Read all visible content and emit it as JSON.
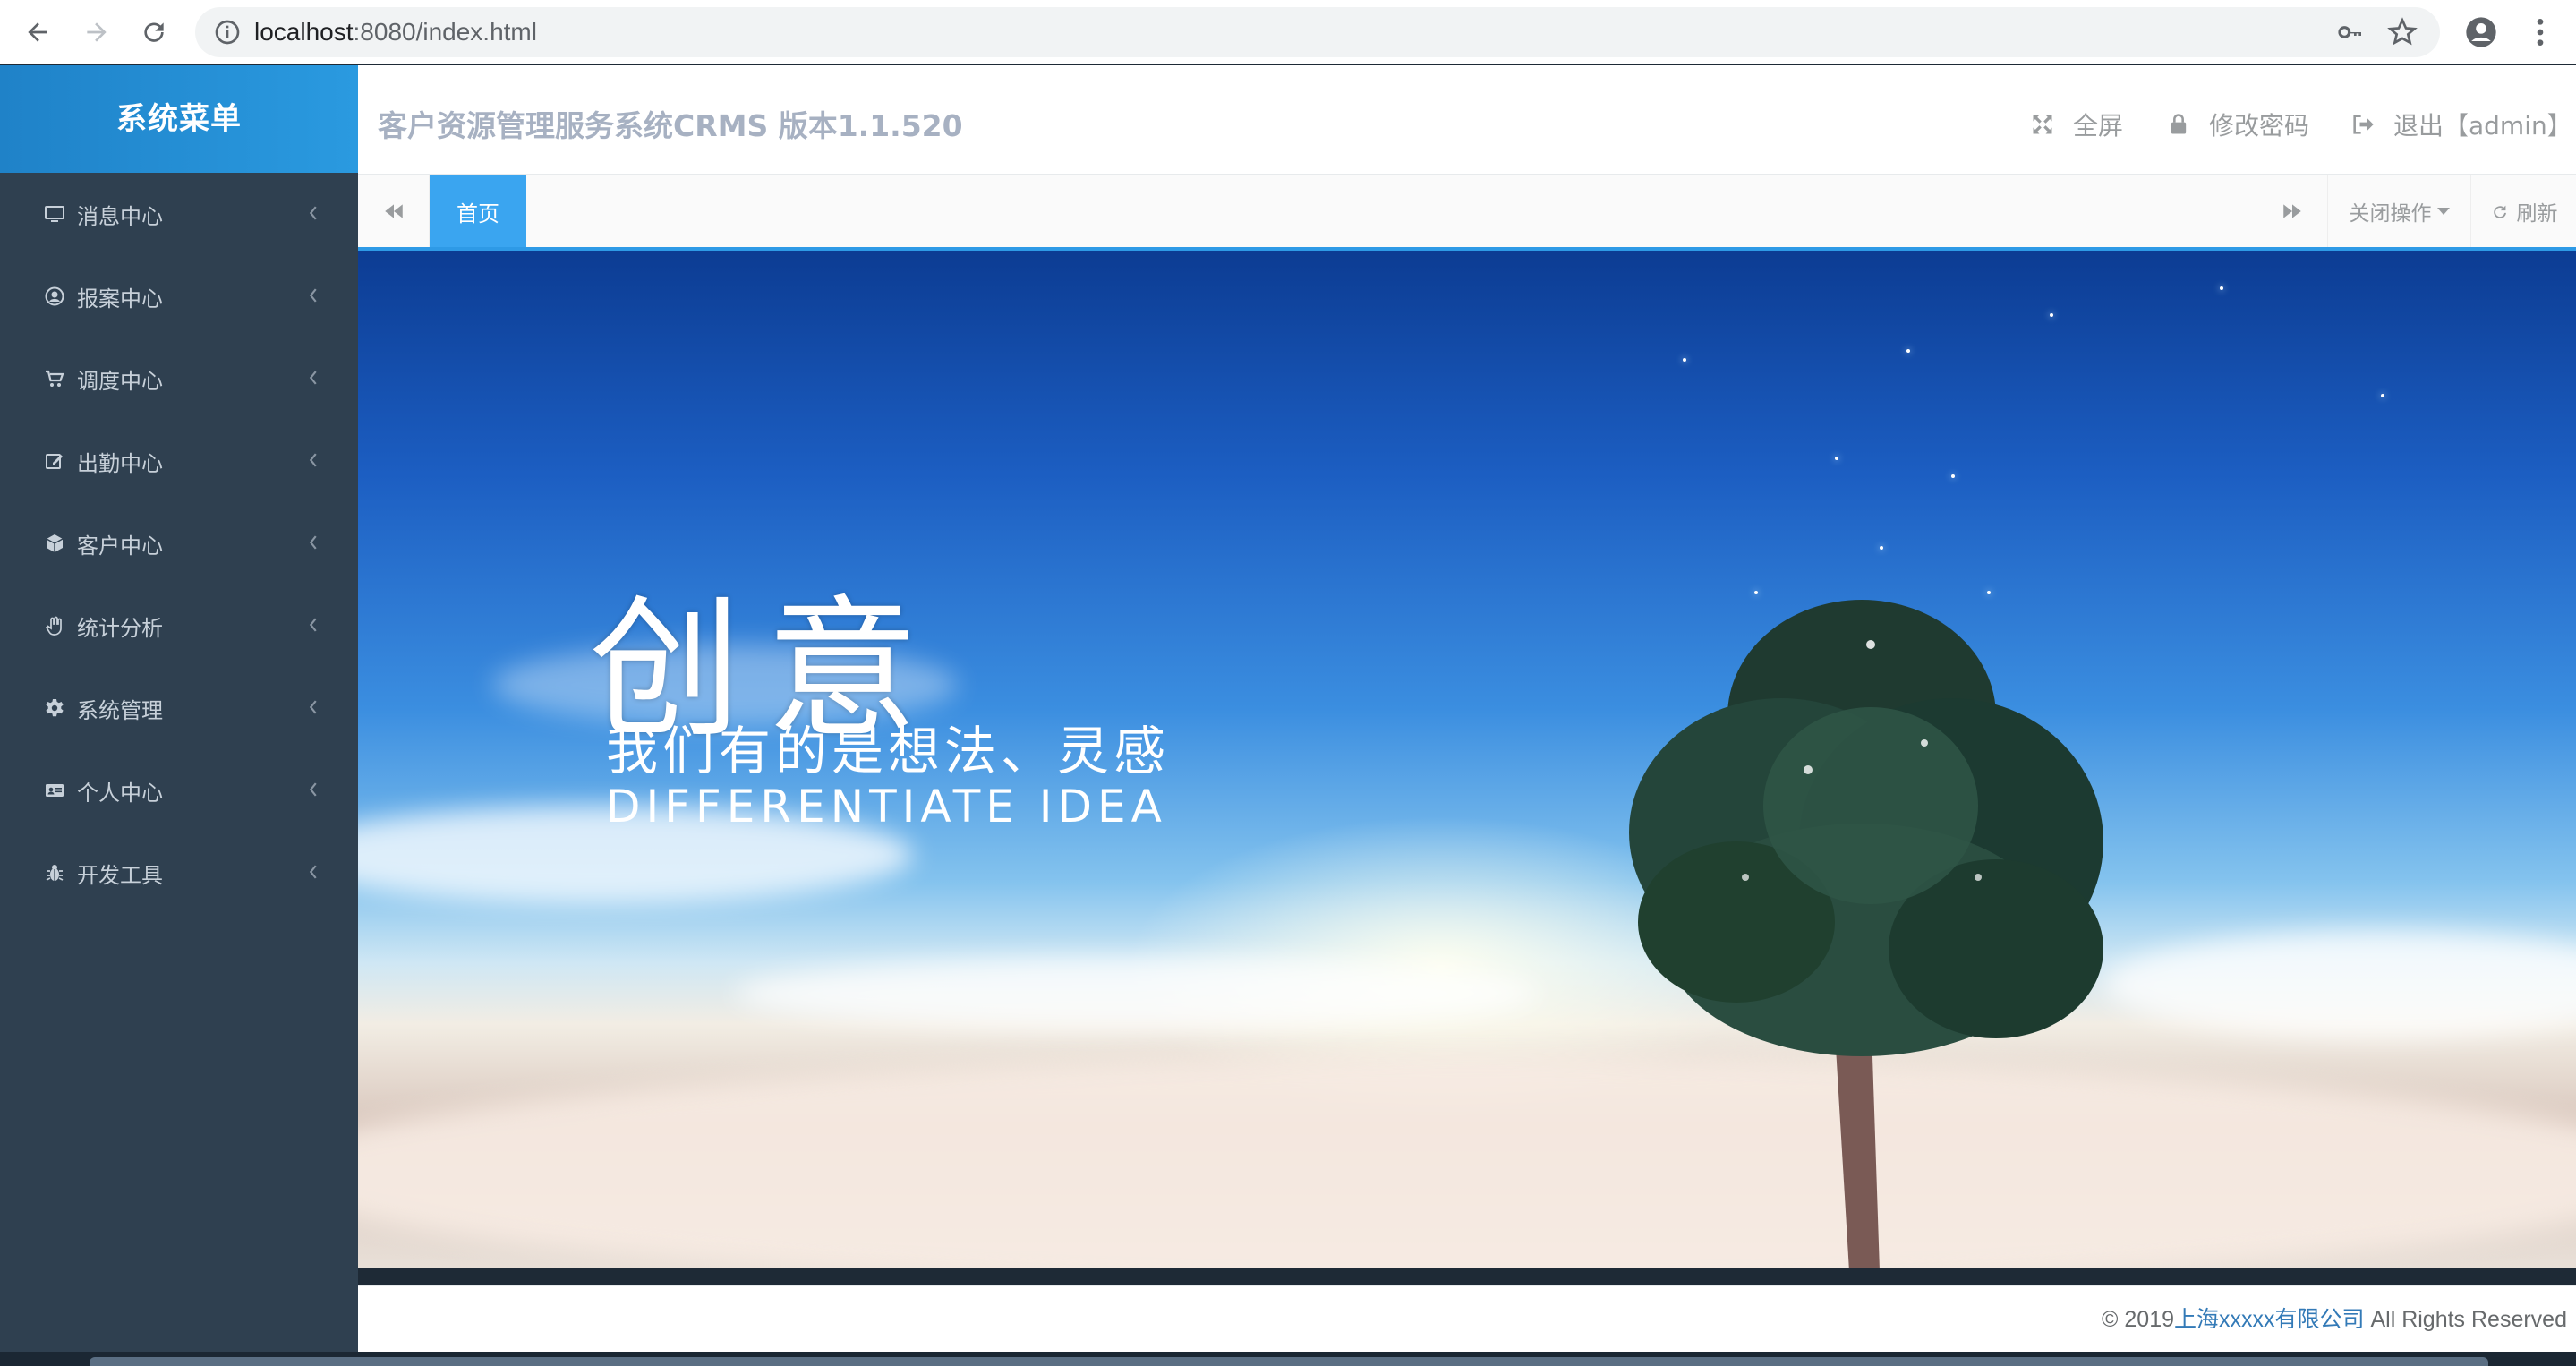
{
  "browser": {
    "url_host": "localhost",
    "url_rest": ":8080/index.html"
  },
  "sidebar": {
    "title": "系统菜单",
    "items": [
      {
        "label": "消息中心",
        "icon": "desktop-icon"
      },
      {
        "label": "报案中心",
        "icon": "user-circle-icon"
      },
      {
        "label": "调度中心",
        "icon": "cart-icon"
      },
      {
        "label": "出勤中心",
        "icon": "edit-icon"
      },
      {
        "label": "客户中心",
        "icon": "cube-icon"
      },
      {
        "label": "统计分析",
        "icon": "hand-icon"
      },
      {
        "label": "系统管理",
        "icon": "gear-icon"
      },
      {
        "label": "个人中心",
        "icon": "id-card-icon"
      },
      {
        "label": "开发工具",
        "icon": "bug-icon"
      }
    ]
  },
  "header": {
    "title": "客户资源管理服务系统CRMS 版本1.1.520",
    "fullscreen_label": "全屏",
    "change_password_label": "修改密码",
    "logout_label": "退出【admin】"
  },
  "tabs": {
    "home_label": "首页",
    "close_ops_label": "关闭操作",
    "refresh_label": "刷新"
  },
  "banner": {
    "headline": "创意",
    "subline": "我们有的是想法、灵感",
    "english": "DIFFERENTIATE IDEA"
  },
  "footer": {
    "prefix": "© 2019",
    "company": "上海xxxxx有限公司",
    "suffix": " All Rights Reserved"
  },
  "colors": {
    "sidebar_bg": "#2f4050",
    "sidebar_head": "#2a9ae0",
    "tab_active": "#3aa5f0",
    "link": "#337ab7"
  }
}
